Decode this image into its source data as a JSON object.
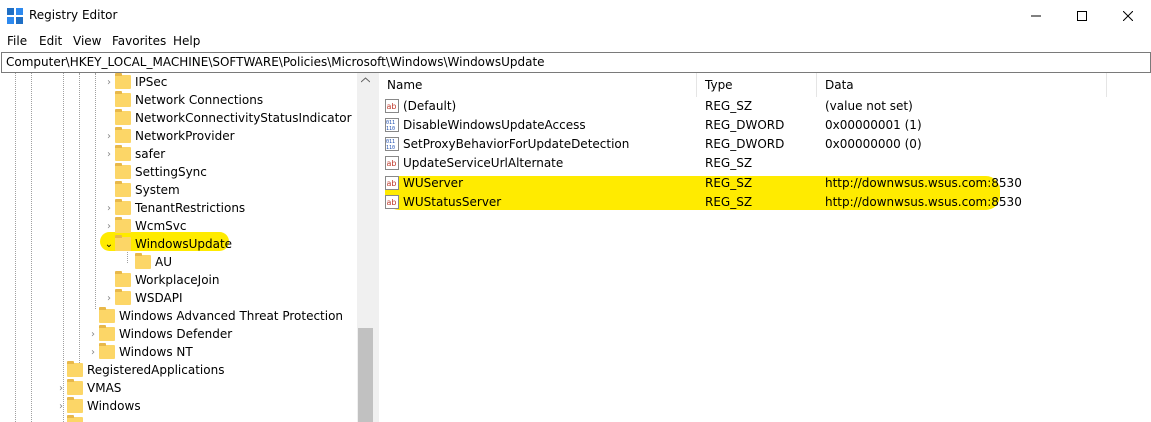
{
  "window": {
    "title": "Registry Editor",
    "icon": "registry-editor-icon"
  },
  "menu": [
    "File",
    "Edit",
    "View",
    "Favorites",
    "Help"
  ],
  "address": "Computer\\HKEY_LOCAL_MACHINE\\SOFTWARE\\Policies\\Microsoft\\Windows\\WindowsUpdate",
  "tree": [
    {
      "label": "IPSec",
      "expander": ">"
    },
    {
      "label": "Network Connections",
      "expander": ""
    },
    {
      "label": "NetworkConnectivityStatusIndicator",
      "expander": ""
    },
    {
      "label": "NetworkProvider",
      "expander": ">"
    },
    {
      "label": "safer",
      "expander": ">"
    },
    {
      "label": "SettingSync",
      "expander": ""
    },
    {
      "label": "System",
      "expander": ""
    },
    {
      "label": "TenantRestrictions",
      "expander": ">"
    },
    {
      "label": "WcmSvc",
      "expander": ">"
    },
    {
      "label": "WindowsUpdate",
      "expander": "v",
      "selected": true
    },
    {
      "label": "AU",
      "expander": ""
    },
    {
      "label": "WorkplaceJoin",
      "expander": ""
    },
    {
      "label": "WSDAPI",
      "expander": ">"
    },
    {
      "label": "Windows Advanced Threat Protection",
      "expander": ""
    },
    {
      "label": "Windows Defender",
      "expander": ">"
    },
    {
      "label": "Windows NT",
      "expander": ">"
    },
    {
      "label": "RegisteredApplications",
      "expander": ""
    },
    {
      "label": "VMAS",
      "expander": ">"
    },
    {
      "label": "Windows",
      "expander": ">"
    }
  ],
  "columns": {
    "name": "Name",
    "type": "Type",
    "data": "Data"
  },
  "values": [
    {
      "name": "(Default)",
      "type": "REG_SZ",
      "data": "(value not set)",
      "icon": "string-value-icon"
    },
    {
      "name": "DisableWindowsUpdateAccess",
      "type": "REG_DWORD",
      "data": "0x00000001 (1)",
      "icon": "dword-value-icon"
    },
    {
      "name": "SetProxyBehaviorForUpdateDetection",
      "type": "REG_DWORD",
      "data": "0x00000000 (0)",
      "icon": "dword-value-icon"
    },
    {
      "name": "UpdateServiceUrlAlternate",
      "type": "REG_SZ",
      "data": "",
      "icon": "string-value-icon"
    },
    {
      "name": "WUServer",
      "type": "REG_SZ",
      "data": "http://downwsus.wsus.com:8530",
      "icon": "string-value-icon"
    },
    {
      "name": "WUStatusServer",
      "type": "REG_SZ",
      "data": "http://downwsus.wsus.com:8530",
      "icon": "string-value-icon"
    }
  ],
  "colors": {
    "highlight": "#ffeb00",
    "folder": "#fcd667"
  }
}
